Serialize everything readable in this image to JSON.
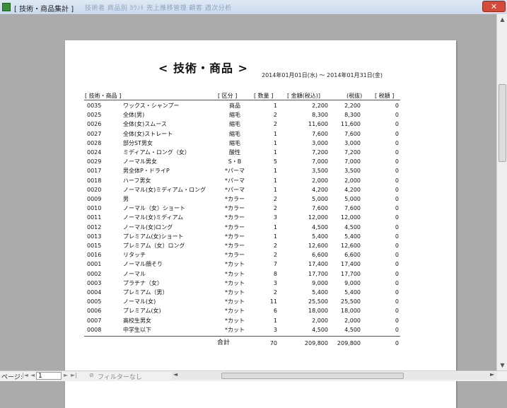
{
  "window": {
    "title": "[ 技術・商品集計 ]",
    "faded_tabs": "技術者 商品別 ｶｳﾝﾄ 売上推移管理 顧客 週次分析",
    "close_label": "✕"
  },
  "report": {
    "title": "< 技術・商品 >",
    "date_range": "2014年01月01日(水) ～ 2014年01月31日(金)",
    "columns": [
      "[ 技術・商品 ]",
      "[ 区分 ]",
      "[ 数量 ]",
      "[ 金額(税込)]",
      "(税抜)",
      "[ 税額 ]"
    ],
    "rows": [
      {
        "code": "0035",
        "name": "ワックス・シャンプー",
        "category": "商品",
        "qty": "1",
        "incl": "2,200",
        "excl": "2,200",
        "tax": "0"
      },
      {
        "code": "0025",
        "name": "全体(男)",
        "category": "縮毛",
        "qty": "2",
        "incl": "8,300",
        "excl": "8,300",
        "tax": "0"
      },
      {
        "code": "0026",
        "name": "全体(女)スムース",
        "category": "縮毛",
        "qty": "2",
        "incl": "11,600",
        "excl": "11,600",
        "tax": "0"
      },
      {
        "code": "0027",
        "name": "全体(女)ストレート",
        "category": "縮毛",
        "qty": "1",
        "incl": "7,600",
        "excl": "7,600",
        "tax": "0"
      },
      {
        "code": "0028",
        "name": "部分ST男女",
        "category": "縮毛",
        "qty": "1",
        "incl": "3,000",
        "excl": "3,000",
        "tax": "0"
      },
      {
        "code": "0024",
        "name": "ミディアム・ロング（女）",
        "category": "酸性",
        "qty": "1",
        "incl": "7,200",
        "excl": "7,200",
        "tax": "0"
      },
      {
        "code": "0029",
        "name": "ノーマル男女",
        "category": "S・B",
        "qty": "5",
        "incl": "7,000",
        "excl": "7,000",
        "tax": "0"
      },
      {
        "code": "0017",
        "name": "男全体P・ドライP",
        "category": "*パーマ",
        "qty": "1",
        "incl": "3,500",
        "excl": "3,500",
        "tax": "0"
      },
      {
        "code": "0018",
        "name": "ハーフ男女",
        "category": "*パーマ",
        "qty": "1",
        "incl": "2,000",
        "excl": "2,000",
        "tax": "0"
      },
      {
        "code": "0020",
        "name": "ノーマル(女)ミディアム・ロング",
        "category": "*パーマ",
        "qty": "1",
        "incl": "4,200",
        "excl": "4,200",
        "tax": "0"
      },
      {
        "code": "0009",
        "name": "男",
        "category": "*カラー",
        "qty": "2",
        "incl": "5,000",
        "excl": "5,000",
        "tax": "0"
      },
      {
        "code": "0010",
        "name": "ノーマル（女）ショート",
        "category": "*カラー",
        "qty": "2",
        "incl": "7,600",
        "excl": "7,600",
        "tax": "0"
      },
      {
        "code": "0011",
        "name": "ノーマル(女)ミディアム",
        "category": "*カラー",
        "qty": "3",
        "incl": "12,000",
        "excl": "12,000",
        "tax": "0"
      },
      {
        "code": "0012",
        "name": "ノーマル(女)ロング",
        "category": "*カラー",
        "qty": "1",
        "incl": "4,500",
        "excl": "4,500",
        "tax": "0"
      },
      {
        "code": "0013",
        "name": "プレミアム(女)ショート",
        "category": "*カラー",
        "qty": "1",
        "incl": "5,400",
        "excl": "5,400",
        "tax": "0"
      },
      {
        "code": "0015",
        "name": "プレミアム（女）ロング",
        "category": "*カラー",
        "qty": "2",
        "incl": "12,600",
        "excl": "12,600",
        "tax": "0"
      },
      {
        "code": "0016",
        "name": "リタッチ",
        "category": "*カラー",
        "qty": "2",
        "incl": "6,600",
        "excl": "6,600",
        "tax": "0"
      },
      {
        "code": "0001",
        "name": "ノーマル顔そり",
        "category": "*カット",
        "qty": "7",
        "incl": "17,400",
        "excl": "17,400",
        "tax": "0"
      },
      {
        "code": "0002",
        "name": "ノーマル",
        "category": "*カット",
        "qty": "8",
        "incl": "17,700",
        "excl": "17,700",
        "tax": "0"
      },
      {
        "code": "0003",
        "name": "プラチナ（女）",
        "category": "*カット",
        "qty": "3",
        "incl": "9,000",
        "excl": "9,000",
        "tax": "0"
      },
      {
        "code": "0004",
        "name": "プレミアム（男）",
        "category": "*カット",
        "qty": "2",
        "incl": "5,400",
        "excl": "5,400",
        "tax": "0"
      },
      {
        "code": "0005",
        "name": "ノーマル(女)",
        "category": "*カット",
        "qty": "11",
        "incl": "25,500",
        "excl": "25,500",
        "tax": "0"
      },
      {
        "code": "0006",
        "name": "プレミアム(女)",
        "category": "*カット",
        "qty": "6",
        "incl": "18,000",
        "excl": "18,000",
        "tax": "0"
      },
      {
        "code": "0007",
        "name": "高校生男女",
        "category": "*カット",
        "qty": "1",
        "incl": "2,000",
        "excl": "2,000",
        "tax": "0"
      },
      {
        "code": "0008",
        "name": "中学生以下",
        "category": "*カット",
        "qty": "3",
        "incl": "4,500",
        "excl": "4,500",
        "tax": "0"
      }
    ],
    "total": {
      "label": "合計",
      "qty": "70",
      "incl": "209,800",
      "excl": "209,800",
      "tax": "0"
    }
  },
  "statusbar": {
    "page_label": "ページ:",
    "nav_first": "|◄",
    "nav_prev": "◄",
    "page_value": "1",
    "nav_next": "►",
    "nav_last": "►|",
    "filter_label": "フィルターなし"
  },
  "scroll": {
    "up": "▲",
    "down": "▼",
    "left": "◄",
    "right": "►"
  }
}
